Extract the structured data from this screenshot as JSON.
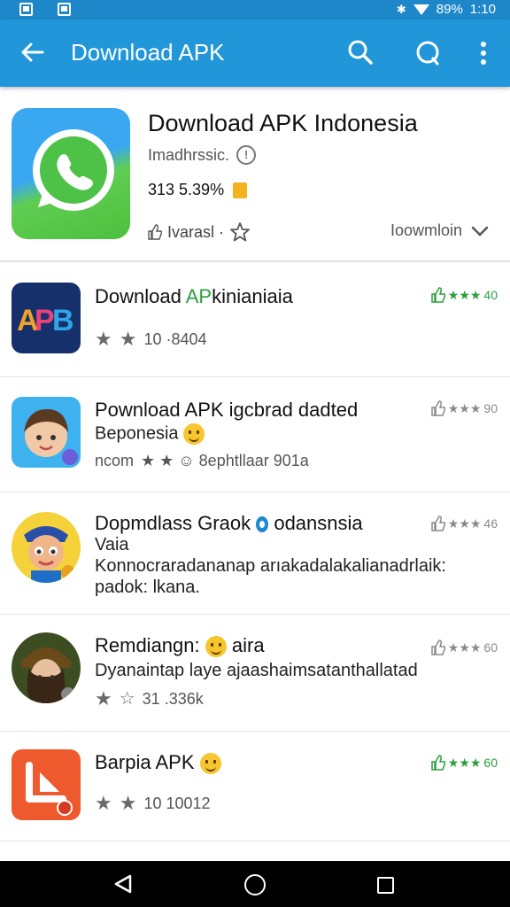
{
  "status_bar": {
    "battery": "89%",
    "time": "1:10"
  },
  "app_bar": {
    "title": "Download APK"
  },
  "featured": {
    "title": "Download APK Indonesia",
    "developer": "Imadhrssic.",
    "size": "313 5.39%",
    "meta": "Ivarasl ·",
    "download_label": "Ioowmloin"
  },
  "list": [
    {
      "name_prefix": "Download ",
      "name_highlight": "AP",
      "name_suffix": "kinianiaia",
      "rating_text": "10 ·8404",
      "score": "40",
      "score_style": "green",
      "icon_text": "APB"
    },
    {
      "name": "Pownload APK igcbrad dadted",
      "line2": "Beponesia",
      "rating_text": "★ ★ ☺ 8ephtllaar 901a",
      "rating_prefix": "ncom",
      "score": "90",
      "score_style": "gray"
    },
    {
      "name": "Dopmdlass Graok",
      "name_suffix": "odansnsia",
      "line2": "Vaia",
      "line3": "Konnocraradananap arıakadalakalianadrlaik:",
      "line4": "padok: lkana.",
      "score": "46",
      "score_style": "gray"
    },
    {
      "name_prefix": "Remdiangn:",
      "name_suffix": "aira",
      "line2": "Dyanaintap laye ajaashaimsatanthallatad",
      "rating_text": "31 .336k",
      "score": "60",
      "score_style": "gray"
    },
    {
      "name": "Barpia APK",
      "rating_text": "10 10012",
      "score": "60",
      "score_style": "green"
    }
  ],
  "colors": {
    "app_bar": "#2196d9",
    "status_bar": "#1d87c9",
    "rating_green": "#2a9f3c"
  }
}
